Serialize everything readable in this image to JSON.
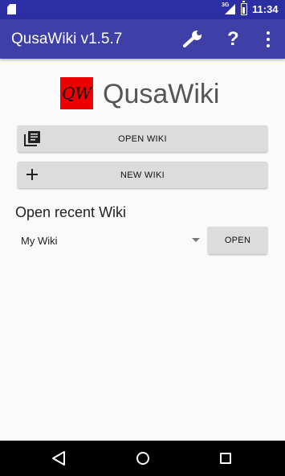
{
  "status_bar": {
    "network": "3G",
    "time": "11:34",
    "icons": [
      "sd-card-icon",
      "signal-icon",
      "battery-icon"
    ]
  },
  "action_bar": {
    "title": "QusaWiki v1.5.7",
    "help_symbol": "?",
    "icons": [
      "settings-wrench-icon",
      "help-icon",
      "overflow-menu-icon"
    ],
    "color": "#3f3fa8"
  },
  "logo": {
    "badge_text": "QW",
    "name": "QusaWiki",
    "badge_color": "#ef0000"
  },
  "buttons": {
    "open_wiki": "OPEN WIKI",
    "new_wiki": "NEW WIKI",
    "open": "OPEN"
  },
  "recent": {
    "heading": "Open recent Wiki",
    "selected": "My Wiki"
  },
  "nav_bar": {
    "icons": [
      "back-icon",
      "home-icon",
      "recents-icon"
    ]
  }
}
